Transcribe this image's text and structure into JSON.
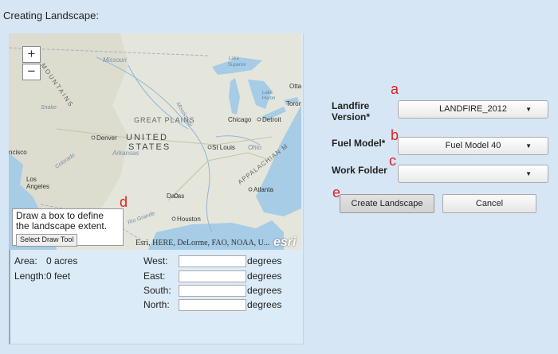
{
  "title": "Creating Landscape:",
  "map": {
    "zoom_in": "+",
    "zoom_out": "−",
    "labels": {
      "missouri": "Missouri",
      "lake_superior_1": "Lake",
      "lake_superior_2": "Superior",
      "lake_huron_1": "Lake",
      "lake_huron_2": "Huron",
      "great_plains": "GREAT PLAINS",
      "chicago": "Chicago",
      "detroit": "Detroit",
      "toronto": "Toron",
      "ottawa": "Otta",
      "united": "UNITED",
      "states": "STATES",
      "denver": "Denver",
      "st_louis": "St Louis",
      "ohio": "Ohio",
      "arkansas": "Arkansas",
      "colorado": "Colorado",
      "cisco": "ncisco",
      "los_angeles_1": "Los",
      "los_angeles_2": "Angeles",
      "dallas": "Dallas",
      "atlanta": "Atlanta",
      "houston": "Houston",
      "rio_grande": "Rio Grande",
      "appalachian": "APPALACHIAN M",
      "mountains": "MOUNTAINS",
      "mississippi": "Mississippi",
      "snake": "Snake"
    },
    "tooltip_text": "Draw a box to define the landscape extent.",
    "draw_tool_label": "Select Draw Tool",
    "attribution": "Esri, HERE, DeLorme, FAO, NOAA, U...",
    "esri_logo": "esri"
  },
  "measurements": {
    "area_label": "Area:",
    "area_value": "0 acres",
    "length_label": "Length:",
    "length_value": "0 feet"
  },
  "extent": {
    "west_label": "West:",
    "east_label": "East:",
    "south_label": "South:",
    "north_label": "North:",
    "unit": "degrees"
  },
  "form": {
    "landfire_label_1": "Landfire",
    "landfire_label_2": "Version*",
    "landfire_value": "LANDFIRE_2012",
    "fuel_label": "Fuel Model*",
    "fuel_value": "Fuel Model 40",
    "workfolder_label": "Work Folder",
    "workfolder_value": ""
  },
  "annotations": {
    "a": "a",
    "b": "b",
    "c": "c",
    "d": "d",
    "e": "e"
  },
  "buttons": {
    "create": "Create Landscape",
    "cancel": "Cancel"
  },
  "colors": {
    "annotation": "#e02020",
    "water": "#a6cce6",
    "land": "#e4e6dc"
  }
}
